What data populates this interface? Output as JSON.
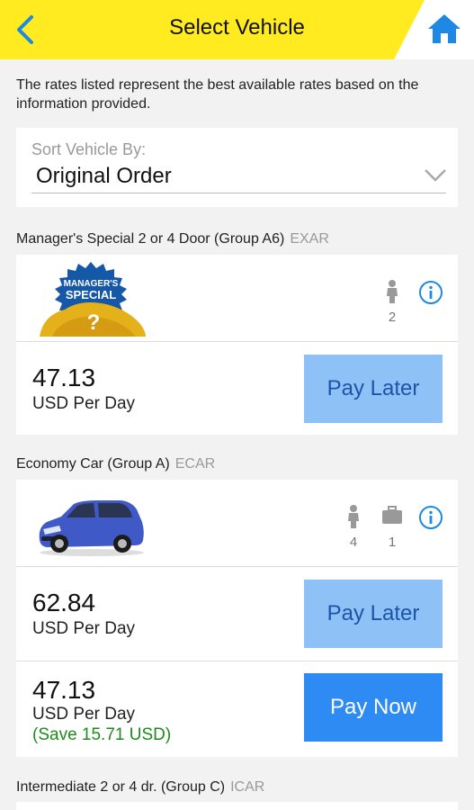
{
  "header": {
    "title": "Select Vehicle",
    "back_icon": "chevron-left-icon",
    "home_icon": "home-icon",
    "colors": {
      "bar": "#ffeb1f",
      "icon": "#1e88e5"
    }
  },
  "intro_text": "The rates listed represent the best available rates based on the information provided.",
  "sort": {
    "label": "Sort Vehicle By:",
    "value": "Original Order"
  },
  "vehicles": [
    {
      "name": "Manager's Special 2 or 4 Door (Group A6)",
      "code": "EXAR",
      "image": "managers-special-badge",
      "badge_text_1": "MANAGER'S",
      "badge_text_2": "SPECIAL",
      "badge_text_3": "?",
      "passengers": "2",
      "rates": [
        {
          "amount": "47.13",
          "unit": "USD Per Day",
          "button": "Pay Later"
        }
      ]
    },
    {
      "name": "Economy Car (Group A)",
      "code": "ECAR",
      "image": "blue-hatchback-car",
      "passengers": "4",
      "bags": "1",
      "rates": [
        {
          "amount": "62.84",
          "unit": "USD Per Day",
          "button": "Pay Later"
        },
        {
          "amount": "47.13",
          "unit": "USD Per Day",
          "save": "(Save 15.71 USD)",
          "button": "Pay Now"
        }
      ]
    },
    {
      "name": "Intermediate 2 or 4 dr. (Group C)",
      "code": "ICAR"
    }
  ],
  "colors": {
    "pay_later_bg": "#8ec1f5",
    "pay_now_bg": "#2d8bf3",
    "save_text": "#1e8a1e",
    "info_icon": "#1e88e5"
  }
}
